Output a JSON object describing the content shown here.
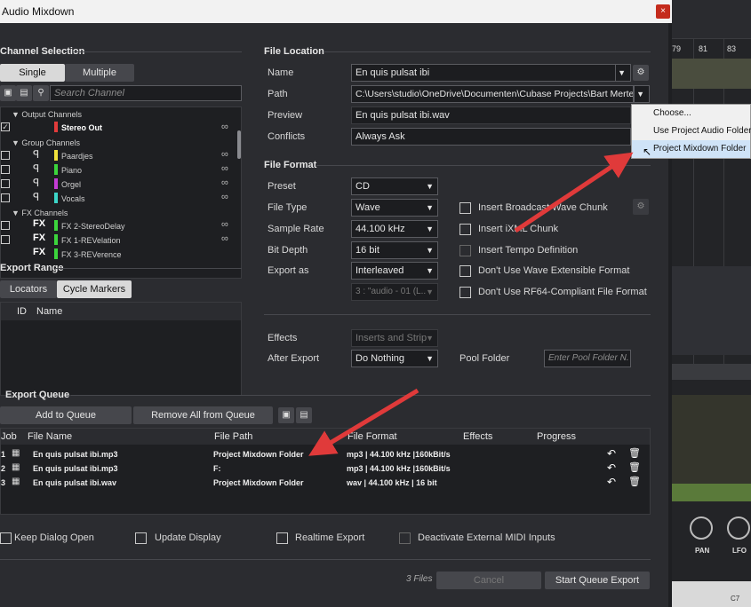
{
  "window": {
    "title": "Audio Mixdown",
    "close": "×"
  },
  "channel_selection": {
    "title": "Channel Selection",
    "single": "Single",
    "multiple": "Multiple",
    "search_placeholder": "Search Channel",
    "tree": [
      {
        "label": "▼ Output Channels",
        "kind": "group"
      },
      {
        "label": "Stereo Out",
        "kind": "channel",
        "color": "#e23b3b",
        "checked": true,
        "icon": ""
      },
      {
        "label": "▼ Group Channels",
        "kind": "group"
      },
      {
        "label": "Paardjes",
        "kind": "channel",
        "color": "#f1e23c",
        "icon": "ꟼ"
      },
      {
        "label": "Piano",
        "kind": "channel",
        "color": "#3cd63c",
        "icon": "ꟼ"
      },
      {
        "label": "Orgel",
        "kind": "channel",
        "color": "#c53cd6",
        "icon": "ꟼ"
      },
      {
        "label": "Vocals",
        "kind": "channel",
        "color": "#3cd6c9",
        "icon": "ꟼ"
      },
      {
        "label": "▼ FX Channels",
        "kind": "group"
      },
      {
        "label": "FX 2-StereoDelay",
        "kind": "channel",
        "color": "#3cd63c",
        "icon": "FX"
      },
      {
        "label": "FX 1-REVelation",
        "kind": "channel",
        "color": "#3cd63c",
        "icon": "FX"
      },
      {
        "label": "FX 3-REVerence",
        "kind": "channel",
        "color": "#3cd63c",
        "icon": "FX"
      }
    ]
  },
  "export_range": {
    "title": "Export Range",
    "locators": "Locators",
    "cycle": "Cycle Markers",
    "col_id": "ID",
    "col_name": "Name"
  },
  "file_location": {
    "title": "File Location",
    "name_label": "Name",
    "name": "En quis pulsat ibi",
    "path_label": "Path",
    "path": "C:\\Users\\studio\\OneDrive\\Documenten\\Cubase Projects\\Bart Merte...",
    "preview_label": "Preview",
    "preview": "En quis pulsat ibi.wav",
    "conflicts_label": "Conflicts",
    "conflicts": "Always Ask"
  },
  "path_menu": {
    "items": [
      "Choose...",
      "Use Project Audio Folder",
      "Project Mixdown Folder"
    ]
  },
  "file_format": {
    "title": "File Format",
    "preset_label": "Preset",
    "preset": "CD",
    "type_label": "File Type",
    "type": "Wave",
    "rate_label": "Sample Rate",
    "rate": "44.100 kHz",
    "depth_label": "Bit Depth",
    "depth": "16 bit",
    "export_as_label": "Export as",
    "export_as": "Interleaved",
    "sub": "3 : \"audio - 01 (L..",
    "opt_bwf": "Insert Broadcast Wave Chunk",
    "opt_ixml": "Insert iXML Chunk",
    "opt_tempo": "Insert Tempo Definition",
    "opt_wavex": "Don't Use Wave Extensible Format",
    "opt_rf64": "Don't Use RF64-Compliant File Format"
  },
  "after": {
    "effects_label": "Effects",
    "effects": "Inserts and Strip",
    "after_label": "After Export",
    "after": "Do Nothing",
    "pool_label": "Pool Folder",
    "pool_placeholder": "Enter Pool Folder N."
  },
  "queue": {
    "title": "Export Queue",
    "add": "Add to Queue",
    "remove": "Remove All from Queue",
    "cols": {
      "job": "Job",
      "file": "File Name",
      "path": "File Path",
      "format": "File Format",
      "effects": "Effects",
      "progress": "Progress"
    },
    "rows": [
      {
        "job": "1",
        "file": "En quis pulsat ibi.mp3",
        "path": "Project Mixdown Folder",
        "format": "mp3 | 44.100 kHz |160kBit/s"
      },
      {
        "job": "2",
        "file": "En quis pulsat ibi.mp3",
        "path": "F:",
        "format": "mp3 | 44.100 kHz |160kBit/s"
      },
      {
        "job": "3",
        "file": "En quis pulsat ibi.wav",
        "path": "Project Mixdown Folder",
        "format": "wav | 44.100 kHz | 16 bit"
      }
    ]
  },
  "footer": {
    "keep": "Keep Dialog Open",
    "update": "Update Display",
    "realtime": "Realtime Export",
    "midi": "Deactivate External MIDI Inputs",
    "files": "3 Files",
    "cancel": "Cancel",
    "start": "Start Queue Export"
  },
  "daw": {
    "ruler": [
      "79",
      "81",
      "83"
    ],
    "pan": "PAN",
    "lfo": "LFO",
    "c7": "C7"
  },
  "colors": {
    "arrow": "#e03a3a",
    "accent": "#3a77c8"
  }
}
